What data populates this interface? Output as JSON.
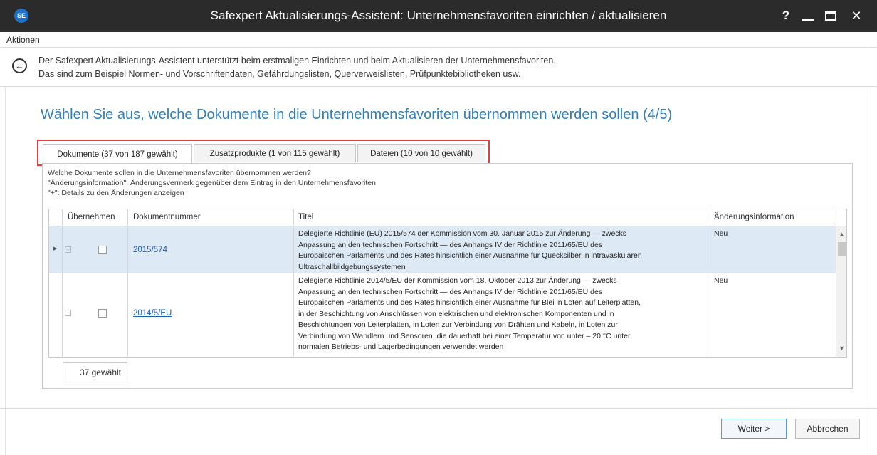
{
  "window": {
    "app_icon_label": "SE",
    "title": "Safexpert Aktualisierungs-Assistent: Unternehmensfavoriten einrichten / aktualisieren",
    "help_label": "?",
    "close_label": "✕"
  },
  "menu": {
    "items": [
      {
        "label": "Aktionen"
      }
    ]
  },
  "info": {
    "back_symbol": "←",
    "line1": "Der Safexpert Aktualisierungs-Assistent unterstützt beim erstmaligen Einrichten und beim Aktualisieren der Unternehmensfavoriten.",
    "line2": "Das sind zum Beispiel Normen- und Vorschriftendaten, Gefährdungslisten, Querverweislisten, Prüfpunktebibliotheken usw."
  },
  "heading": "Wählen Sie aus, welche Dokumente in die Unternehmensfavoriten übernommen werden sollen (4/5)",
  "tabs": [
    {
      "label": "Dokumente (37 von 187 gewählt)",
      "active": true
    },
    {
      "label": "Zusatzprodukte (1 von 115 gewählt)",
      "active": false
    },
    {
      "label": "Dateien (10 von 10 gewählt)",
      "active": false
    }
  ],
  "description": {
    "line1": "Welche Dokumente sollen in die Unternehmensfavoriten übernommen werden?",
    "line2": "\"Änderungsinformation\": Änderungsvermerk gegenüber dem Eintrag in den Unternehmensfavoriten",
    "line3": "\"+\": Details zu den Änderungen anzeigen"
  },
  "table": {
    "columns": [
      "Übernehmen",
      "Dokumentnummer",
      "Titel",
      "Änderungsinformation"
    ],
    "rows": [
      {
        "checked": false,
        "docnum": "2015/574",
        "title_lines": [
          "Delegierte Richtlinie (EU) 2015/574 der Kommission vom 30. Januar 2015 zur Änderung — zwecks",
          "Anpassung an den technischen Fortschritt — des Anhangs IV der Richtlinie 2011/65/EU des",
          "Europäischen Parlaments und des Rates hinsichtlich einer Ausnahme für Quecksilber in intravaskulären",
          "Ultraschallbildgebungssystemen"
        ],
        "change": "Neu"
      },
      {
        "checked": false,
        "docnum": "2014/5/EU",
        "title_lines": [
          "Delegierte Richtlinie 2014/5/EU der Kommission vom 18. Oktober 2013 zur Änderung — zwecks",
          "Anpassung an den technischen Fortschritt — des Anhangs IV der Richtlinie 2011/65/EU des",
          "Europäischen Parlaments und des Rates hinsichtlich einer Ausnahme für Blei in Loten auf Leiterplatten,",
          "in der Beschichtung von Anschlüssen von elektrischen und elektronischen Komponenten und in",
          "Beschichtungen von Leiterplatten, in Loten zur Verbindung von Drähten und Kabeln, in Loten zur",
          "Verbindung von Wandlern und Sensoren, die dauerhaft bei einer Temperatur von unter – 20 °C unter",
          "normalen Betriebs- und Lagerbedingungen verwendet werden"
        ],
        "change": "Neu"
      }
    ],
    "footer": "37 gewählt"
  },
  "buttons": {
    "next": "Weiter >",
    "cancel": "Abbrechen"
  },
  "colors": {
    "titlebar": "#2b2b2b",
    "heading": "#2f7fb8",
    "selected_row": "#ddeaf6",
    "tab_highlight": "#e04040",
    "link": "#1f5fa8"
  }
}
